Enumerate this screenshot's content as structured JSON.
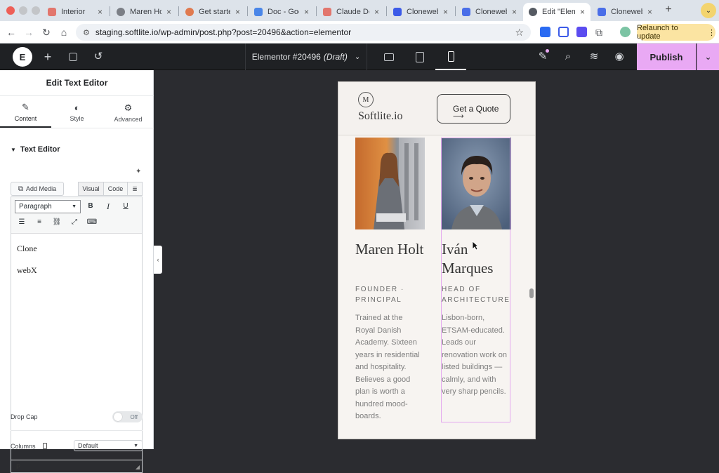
{
  "browser": {
    "tabs": [
      {
        "title": "Interior",
        "fav": "#e2766d"
      },
      {
        "title": "Maren Holt",
        "fav": "#7b7f86"
      },
      {
        "title": "Get started",
        "fav": "#e07a4f"
      },
      {
        "title": "Doc - Goog",
        "fav": "#4a86e8"
      },
      {
        "title": "Claude Des",
        "fav": "#e2766d"
      },
      {
        "title": "ClonewebX",
        "fav": "#3c5be8"
      },
      {
        "title": "ClonewebX",
        "fav": "#4a6ee8"
      },
      {
        "title": "Edit \"Eleme",
        "fav": "#555a62"
      },
      {
        "title": "ClonewebX",
        "fav": "#4a6ee8"
      }
    ],
    "url": "staging.softlite.io/wp-admin/post.php?post=20496&action=elementor",
    "relaunch_label": "Relaunch to update"
  },
  "elementor": {
    "doc_title": "Elementor #20496",
    "doc_status": "(Draft)",
    "publish_label": "Publish"
  },
  "panel": {
    "title": "Edit Text Editor",
    "tabs": [
      "Content",
      "Style",
      "Advanced"
    ],
    "section": "Text Editor",
    "add_media": "Add Media",
    "visual_tab": "Visual",
    "code_tab": "Code",
    "format": "Paragraph",
    "bold": "B",
    "italic": "I",
    "underline": "U",
    "content_lines": [
      "Clone",
      "webX"
    ],
    "path": "P",
    "drop_cap_label": "Drop Cap",
    "drop_cap_value": "Off",
    "columns_label": "Columns",
    "columns_value": "Default"
  },
  "site": {
    "logo_letter": "M",
    "brand": "Softlite.io",
    "cta": "Get a Quote",
    "people": [
      {
        "name": "Maren Holt",
        "role": "FOUNDER · PRINCIPAL",
        "bio": "Trained at the Royal Danish Academy. Sixteen years in residential and hospitality. Believes a good plan is worth a hundred mood-boards."
      },
      {
        "name": "Iván Marques",
        "role": "HEAD OF ARCHITECTURE",
        "bio": "Lisbon-born, ETSAM-educated. Leads our renovation work on listed buildings — calmly, and with very sharp pencils."
      }
    ]
  }
}
